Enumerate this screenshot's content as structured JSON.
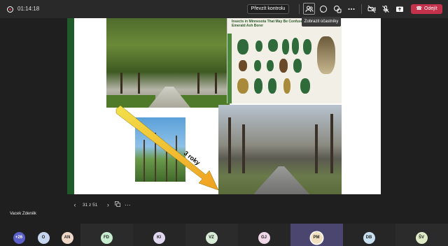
{
  "topbar": {
    "timer": "01:14:18",
    "take_control_label": "Převzít kontrolu",
    "tooltip": "Zobrazit účastníky",
    "leave_label": "Odejít"
  },
  "slide": {
    "poster_title": "Insects in Minnesota That May Be Confused With Emerald Ash Borer",
    "poster_subtitle": "",
    "caption_top": "",
    "caption_bottom": "",
    "arrow_label": "3 roky"
  },
  "slide_nav": {
    "counter": "31 z 51"
  },
  "presenter_name": "Vacek Zdeněk",
  "participants": [
    {
      "initials": "+26",
      "color": "#5b5fc7",
      "text_color": "#ffffff"
    },
    {
      "initials": "O",
      "color": "#c7d6f0",
      "text_color": "#222222"
    },
    {
      "initials": "AN",
      "color": "#f0d8c8",
      "text_color": "#222222"
    },
    {
      "initials": "FD",
      "color": "#c8ecd0",
      "text_color": "#222222"
    },
    {
      "initials": "KI",
      "color": "#e0d8f0",
      "text_color": "#222222"
    },
    {
      "initials": "VZ",
      "color": "#d8ecd8",
      "text_color": "#222222"
    },
    {
      "initials": "GJ",
      "color": "#f0d8e8",
      "text_color": "#222222"
    },
    {
      "initials": "PM",
      "color": "#f0e0c0",
      "text_color": "#222222"
    },
    {
      "initials": "DB",
      "color": "#c8e0f0",
      "text_color": "#222222"
    },
    {
      "initials": "ŠV",
      "color": "#e0ecc8",
      "text_color": "#222222"
    }
  ]
}
